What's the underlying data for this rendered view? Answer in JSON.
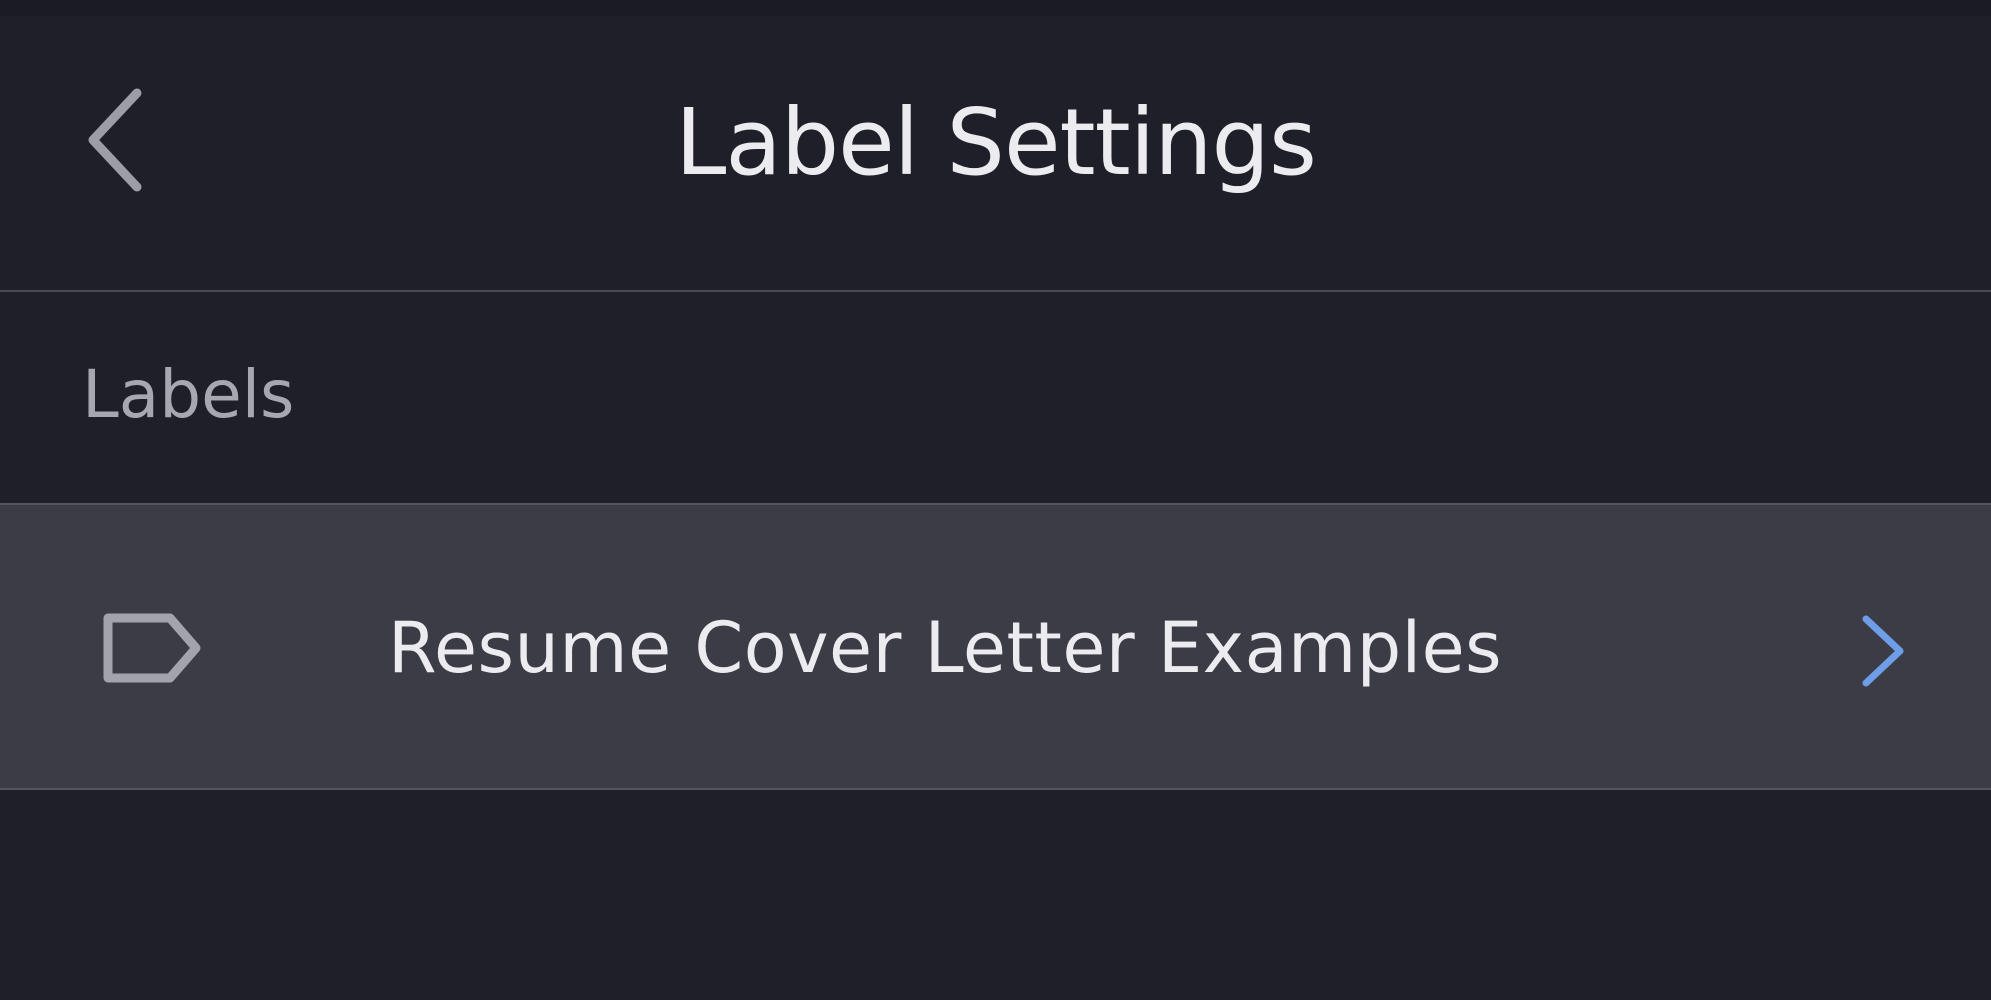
{
  "header": {
    "title": "Label Settings",
    "back_icon": "chevron-left-icon"
  },
  "labels_section": {
    "title": "Labels",
    "items": [
      {
        "name": "Resume Cover Letter Examples",
        "icon": "label-tag-icon",
        "trailing_icon": "chevron-right-icon"
      }
    ]
  },
  "colors": {
    "background": "#1f1f29",
    "row_background": "#3c3c47",
    "accent": "#6f9ee8",
    "primary_text": "#ececf0",
    "secondary_text": "#a7a7af"
  }
}
